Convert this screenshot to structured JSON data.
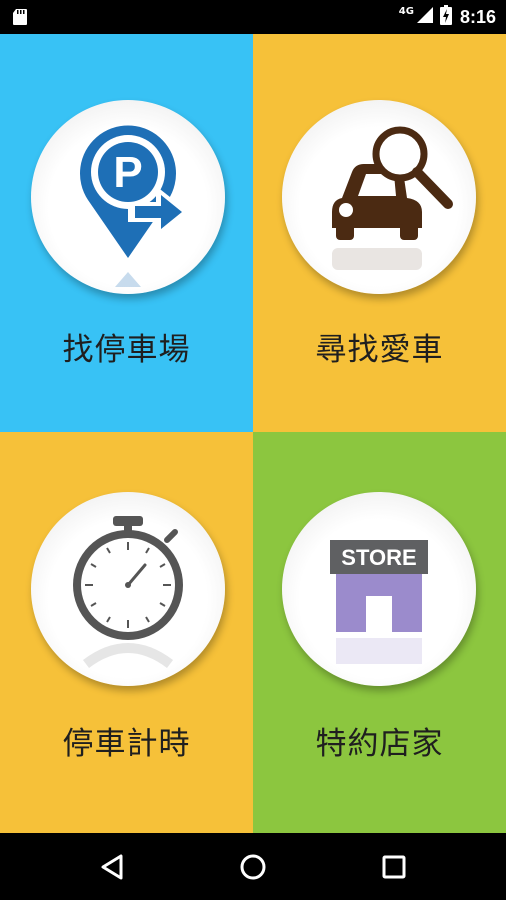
{
  "status_bar": {
    "time": "8:16",
    "network_type": "4G",
    "icons": [
      "sd-card-icon",
      "signal-icon",
      "battery-charging-icon"
    ]
  },
  "tiles": [
    {
      "label": "找停車場",
      "icon": "parking-marker-arrow-icon",
      "background": "#38C2F5"
    },
    {
      "label": "尋找愛車",
      "icon": "car-magnifier-icon",
      "background": "#F6C139"
    },
    {
      "label": "停車計時",
      "icon": "stopwatch-icon",
      "background": "#F6C139"
    },
    {
      "label": "特約店家",
      "icon": "store-icon",
      "background": "#8CC63F",
      "icon_text": "STORE"
    }
  ],
  "colors": {
    "parking_blue": "#1E6FB6",
    "car_brown": "#4B2A12",
    "store_purple": "#9B8BCC",
    "store_sign": "#5F6062"
  },
  "nav_bar": {
    "buttons": [
      "back-icon",
      "home-icon",
      "recents-icon"
    ]
  }
}
